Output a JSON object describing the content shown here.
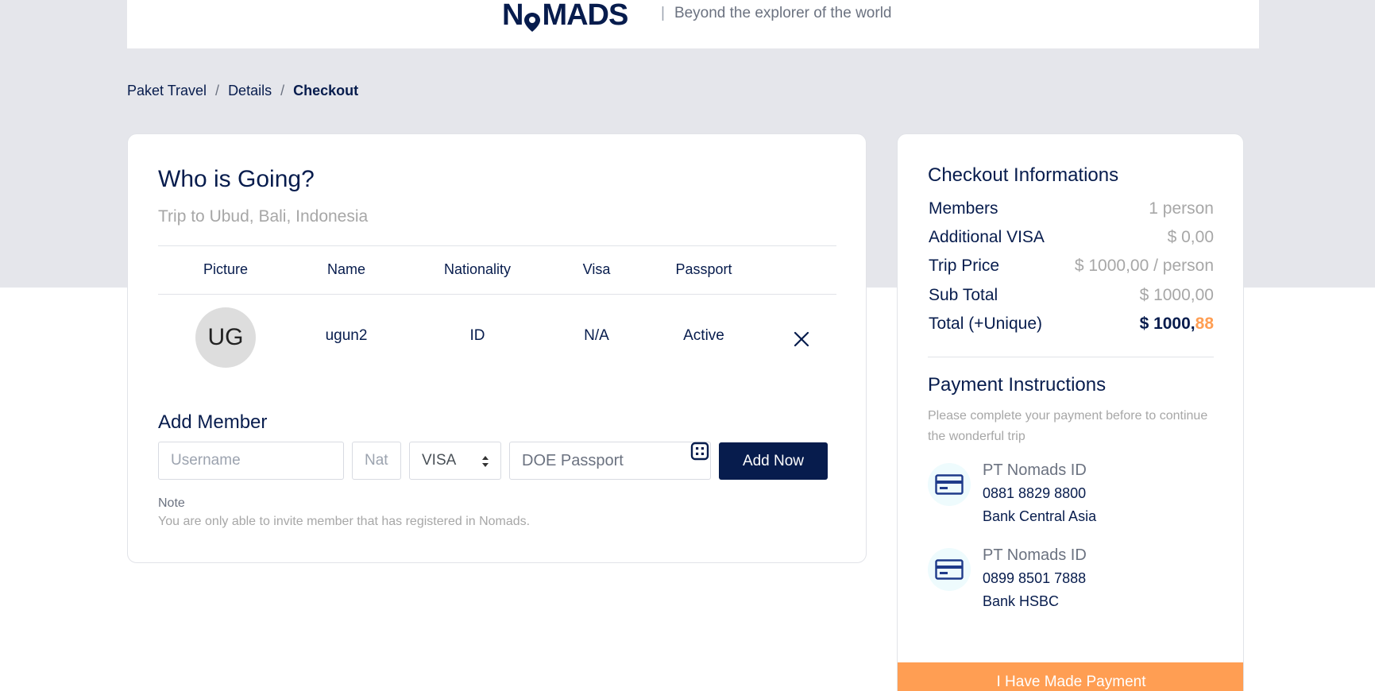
{
  "header": {
    "logo_pre": "N",
    "logo_post": "MADS",
    "tagline_sep": "|",
    "tagline": "Beyond the explorer of the world"
  },
  "breadcrumb": {
    "items": [
      "Paket Travel",
      "Details",
      "Checkout"
    ],
    "separator": "/"
  },
  "who": {
    "title": "Who is Going?",
    "subtitle": "Trip to Ubud, Bali, Indonesia",
    "columns": [
      "Picture",
      "Name",
      "Nationality",
      "Visa",
      "Passport"
    ],
    "rows": [
      {
        "initials": "UG",
        "name": "ugun2",
        "nationality": "ID",
        "visa": "N/A",
        "passport": "Active"
      }
    ]
  },
  "add_member": {
    "title": "Add Member",
    "username_placeholder": "Username",
    "nat_placeholder": "Nat",
    "visa_value": "VISA",
    "passport_placeholder": "DOE Passport",
    "button": "Add Now",
    "note_title": "Note",
    "note_text": "You are only able to invite member that has registered in Nomads."
  },
  "checkout": {
    "title": "Checkout Informations",
    "rows": [
      {
        "label": "Members",
        "value": "1 person"
      },
      {
        "label": "Additional VISA",
        "value": "$ 0,00"
      },
      {
        "label": "Trip Price",
        "value": "$ 1000,00 / person"
      },
      {
        "label": "Sub Total",
        "value": "$ 1000,00"
      },
      {
        "label": "Total (+Unique)",
        "value_main": "$ 1000,",
        "value_unique": "88"
      }
    ]
  },
  "payment": {
    "title": "Payment Instructions",
    "description": "Please complete your payment before to continue the wonderful trip",
    "banks": [
      {
        "name": "PT Nomads ID",
        "number": "0881 8829 8800",
        "bank": "Bank Central Asia"
      },
      {
        "name": "PT Nomads ID",
        "number": "0899 8501 7888",
        "bank": "Bank HSBC"
      }
    ],
    "button": "I Have Made Payment"
  },
  "colors": {
    "brand_navy": "#071c4d",
    "accent_orange": "#ff9e53",
    "page_band": "#e5e6eb",
    "muted_text": "#a7a7a7"
  },
  "icons": [
    "map-pin-icon",
    "close-icon",
    "select-caret-icon",
    "calendar-icon",
    "credit-card-icon"
  ]
}
